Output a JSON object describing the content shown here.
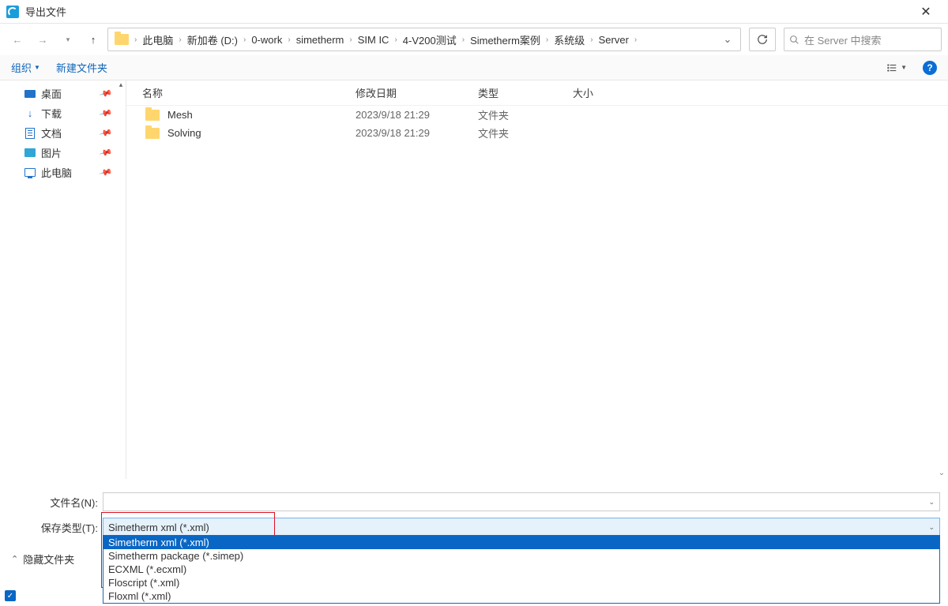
{
  "window": {
    "title": "导出文件",
    "close": "✕"
  },
  "nav": {
    "back": "←",
    "fwd": "→",
    "up": "↑"
  },
  "breadcrumbs": [
    "此电脑",
    "新加卷 (D:)",
    "0-work",
    "simetherm",
    "SIM IC",
    "4-V200测试",
    "Simetherm案例",
    "系统级",
    "Server"
  ],
  "search": {
    "placeholder": "在 Server 中搜索"
  },
  "toolbar": {
    "organize": "组织",
    "newfolder": "新建文件夹",
    "help": "?"
  },
  "sidebar": {
    "items": [
      {
        "label": "桌面",
        "icon": "desktop"
      },
      {
        "label": "下载",
        "icon": "download"
      },
      {
        "label": "文档",
        "icon": "doc"
      },
      {
        "label": "图片",
        "icon": "pic"
      },
      {
        "label": "此电脑",
        "icon": "pc"
      }
    ]
  },
  "columns": {
    "name": "名称",
    "date": "修改日期",
    "type": "类型",
    "size": "大小"
  },
  "files": [
    {
      "name": "Mesh",
      "date": "2023/9/18 21:29",
      "type": "文件夹"
    },
    {
      "name": "Solving",
      "date": "2023/9/18 21:29",
      "type": "文件夹"
    }
  ],
  "fields": {
    "filename_label": "文件名(N):",
    "filename_value": "",
    "type_label": "保存类型(T):",
    "type_value": "Simetherm xml (*.xml)"
  },
  "type_options": [
    "Simetherm xml (*.xml)",
    "Simetherm package (*.simep)",
    "ECXML (*.ecxml)",
    "Floscript (*.xml)",
    "Floxml (*.xml)"
  ],
  "hide_folders": "隐藏文件夹"
}
